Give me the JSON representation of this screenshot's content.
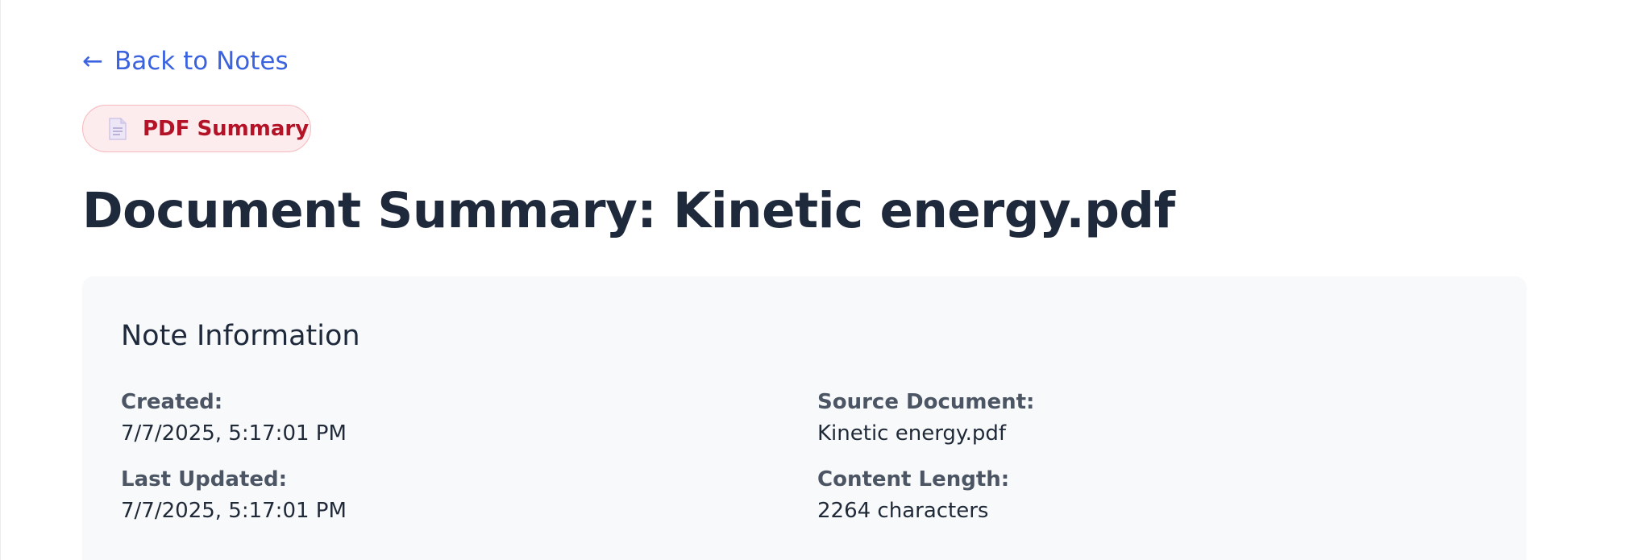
{
  "nav": {
    "back_arrow": "←",
    "back_label": "Back to Notes",
    "link_color": "#3b63e0"
  },
  "badge": {
    "icon": "document-icon",
    "label": "PDF Summary",
    "text_color": "#b41327",
    "background_color": "#fdecee",
    "border_color": "#f7b9bd"
  },
  "page": {
    "title": "Document Summary: Kinetic energy.pdf"
  },
  "note_info": {
    "heading": "Note Information",
    "created_label": "Created:",
    "created_value": "7/7/2025, 5:17:01 PM",
    "updated_label": "Last Updated:",
    "updated_value": "7/7/2025, 5:17:01 PM",
    "source_label": "Source Document:",
    "source_value": "Kinetic energy.pdf",
    "length_label": "Content Length:",
    "length_value": "2264 characters"
  }
}
